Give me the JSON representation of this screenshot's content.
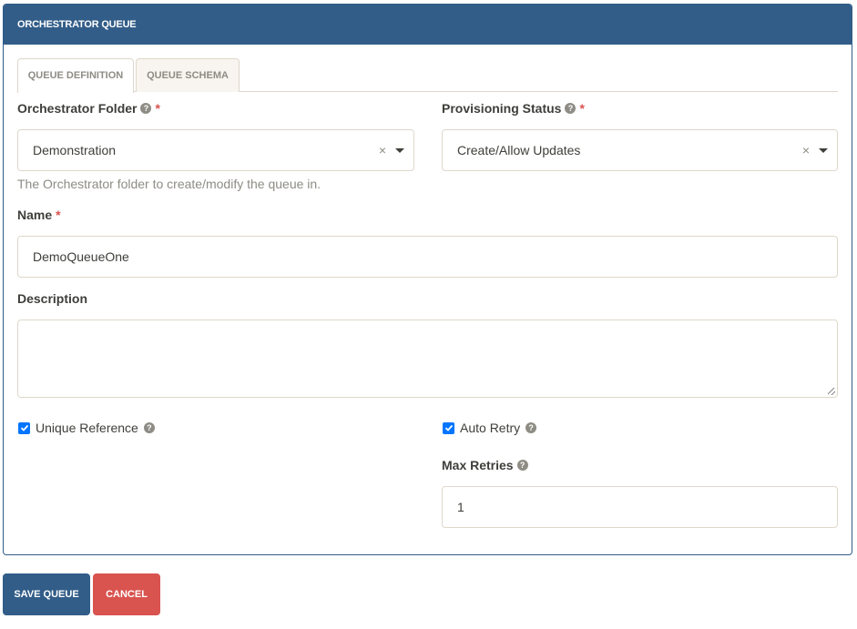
{
  "panel": {
    "title": "ORCHESTRATOR QUEUE",
    "header_color": "#325d88"
  },
  "tabs": [
    {
      "label": "QUEUE DEFINITION",
      "active": true
    },
    {
      "label": "QUEUE SCHEMA",
      "active": false
    }
  ],
  "form": {
    "folder": {
      "label": "Orchestrator Folder",
      "required_mark": "*",
      "value": "Demonstration",
      "help_text": "The Orchestrator folder to create/modify the queue in.",
      "clear_icon": "×"
    },
    "provisioning_status": {
      "label": "Provisioning Status",
      "required_mark": "*",
      "value": "Create/Allow Updates",
      "clear_icon": "×"
    },
    "name": {
      "label": "Name",
      "required_mark": "*",
      "value": "DemoQueueOne"
    },
    "description": {
      "label": "Description",
      "value": ""
    },
    "unique_reference": {
      "label": "Unique Reference",
      "checked": true
    },
    "auto_retry": {
      "label": "Auto Retry",
      "checked": true
    },
    "max_retries": {
      "label": "Max Retries",
      "value": "1"
    },
    "help_icon_glyph": "?"
  },
  "actions": {
    "save_label": "SAVE QUEUE",
    "cancel_label": "CANCEL",
    "save_color": "#325d88",
    "cancel_color": "#d9534f"
  }
}
